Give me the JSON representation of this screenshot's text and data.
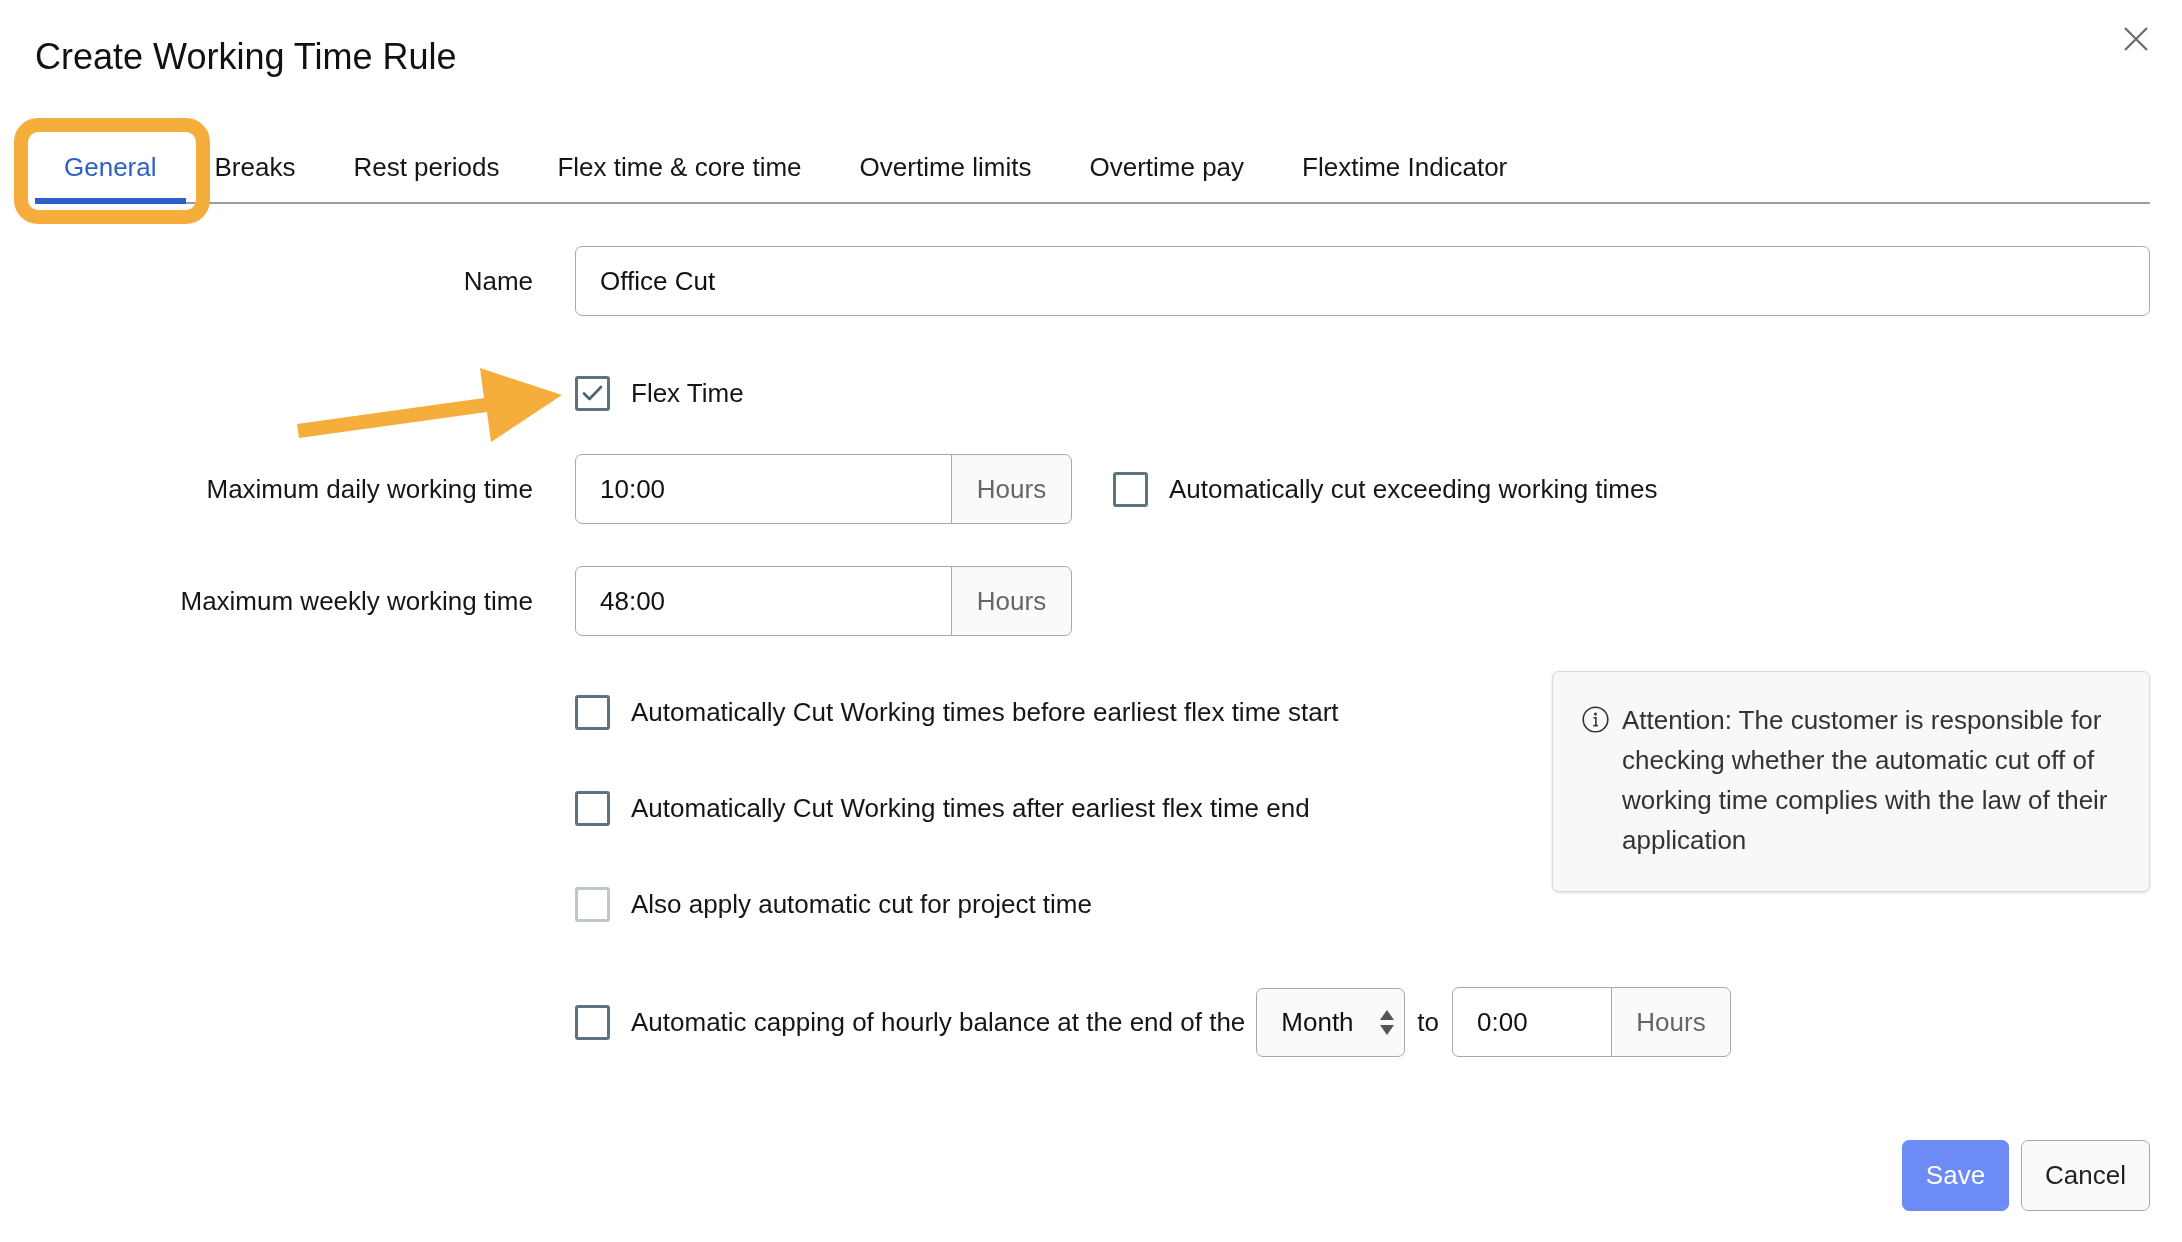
{
  "dialog": {
    "title": "Create Working Time Rule"
  },
  "tabs": [
    {
      "label": "General",
      "selected": true,
      "highlighted": true
    },
    {
      "label": "Breaks",
      "selected": false,
      "highlighted": false
    },
    {
      "label": "Rest periods",
      "selected": false,
      "highlighted": false
    },
    {
      "label": "Flex time & core time",
      "selected": false,
      "highlighted": false
    },
    {
      "label": "Overtime limits",
      "selected": false,
      "highlighted": false
    },
    {
      "label": "Overtime pay",
      "selected": false,
      "highlighted": false
    },
    {
      "label": "Flextime Indicator",
      "selected": false,
      "highlighted": false
    }
  ],
  "fields": [
    {
      "kind": "text",
      "label": "Name",
      "value": "Office Cut",
      "arrow": false
    },
    {
      "kind": "checkbox",
      "label": "Flex Time",
      "checked": true,
      "arrow": true
    },
    {
      "kind": "duration",
      "label": "Maximum daily working time",
      "value": "10:00",
      "unit": "Hours",
      "arrow": false,
      "option": {
        "label": "Automatically cut exceeding working times",
        "checked": false
      }
    },
    {
      "kind": "duration",
      "label": "Maximum weekly working time",
      "value": "48:00",
      "unit": "Hours",
      "arrow": false
    }
  ],
  "cut_options": [
    {
      "label": "Automatically Cut Working times before earliest flex time start",
      "checked": false,
      "disabled": false
    },
    {
      "label": "Automatically Cut Working times after earliest flex time end",
      "checked": false,
      "disabled": false
    },
    {
      "label": "Also apply automatic cut for project time",
      "checked": false,
      "disabled": true
    }
  ],
  "notice": {
    "text": "Attention: The customer is responsible for checking whether the automatic cut off of working time complies with the law of their application"
  },
  "capping": {
    "label": "Automatic capping of hourly balance at the end of the",
    "checked": false,
    "period": "Month",
    "connector": "to",
    "value": "0:00",
    "unit": "Hours"
  },
  "buttons": [
    {
      "label": "Save",
      "kind": "primary"
    },
    {
      "label": "Cancel",
      "kind": "secondary"
    }
  ]
}
